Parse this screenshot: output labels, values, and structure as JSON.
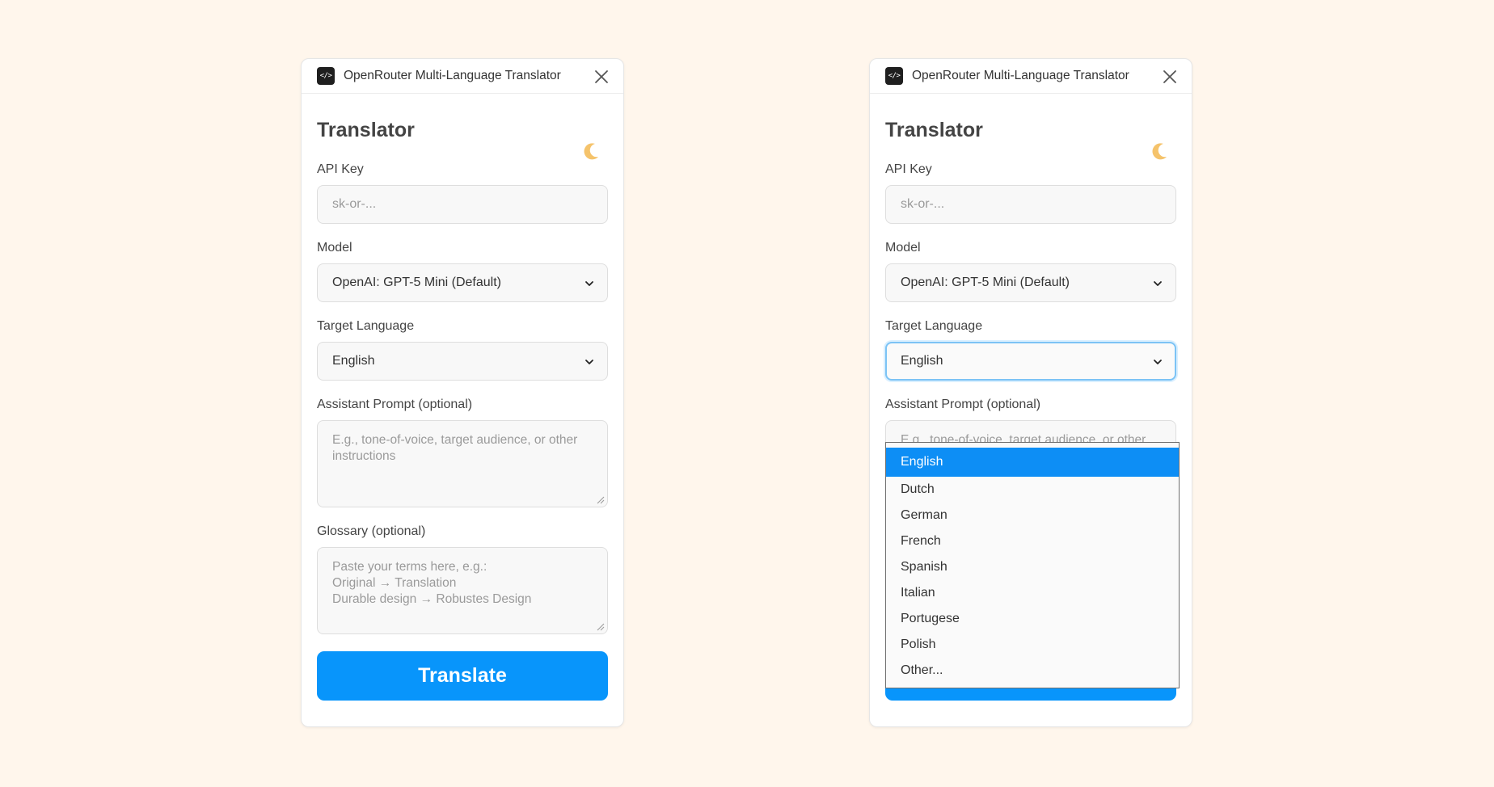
{
  "window": {
    "title": "OpenRouter Multi-Language Translator",
    "app_icon_glyph": "</>",
    "close_icon": "close-icon"
  },
  "header": {
    "title": "Translator",
    "theme_icon": "moon-icon"
  },
  "fields": {
    "api_key_label": "API Key",
    "api_key_placeholder": "sk-or-...",
    "api_key_value": "",
    "model_label": "Model",
    "model_value": "OpenAI: GPT-5 Mini (Default)",
    "target_language_label": "Target Language",
    "target_language_value": "English",
    "assistant_prompt_label": "Assistant Prompt (optional)",
    "assistant_prompt_placeholder": "E.g., tone-of-voice, target audience, or other instructions",
    "glossary_label": "Glossary (optional)",
    "glossary_placeholder": "Paste your terms here, e.g.:\nOriginal → Translation\nDurable design → Robustes Design"
  },
  "actions": {
    "translate_label": "Translate"
  },
  "language_dropdown": {
    "open": true,
    "selected": "English",
    "options": [
      "English",
      "Dutch",
      "German",
      "French",
      "Spanish",
      "Italian",
      "Portugese",
      "Polish",
      "Other..."
    ]
  },
  "colors": {
    "background": "#fff6ec",
    "accent": "#0895fb",
    "selected_option": "#0d8ef5",
    "moon": "#f5c36b"
  }
}
